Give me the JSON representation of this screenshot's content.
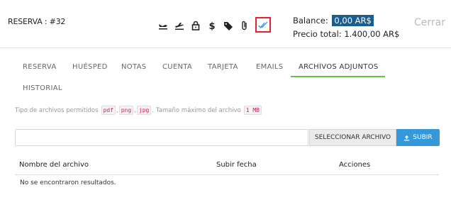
{
  "header": {
    "title": "RESERVA : #32",
    "balance_label": "Balance:",
    "balance_value": "0,00 AR$",
    "total_label": "Precio total: 1.400,00 AR$",
    "close_label": "Cerrar"
  },
  "icons": [
    "plane-arrival-icon",
    "plane-departure-icon",
    "lock-icon",
    "dollar-icon",
    "tags-icon",
    "paperclip-icon",
    "double-check-icon"
  ],
  "tabs": [
    {
      "label": "RESERVA"
    },
    {
      "label": "HUÉSPED"
    },
    {
      "label": "NOTAS"
    },
    {
      "label": "CUENTA"
    },
    {
      "label": "TARJETA"
    },
    {
      "label": "EMAILS"
    },
    {
      "label": "ARCHIVOS ADJUNTOS"
    },
    {
      "label": "HISTORIAL"
    }
  ],
  "active_tab": "ARCHIVOS ADJUNTOS",
  "info": {
    "prefix": "Tipo de archivos permitidos",
    "types": [
      "pdf",
      "png",
      "jpg"
    ],
    "size_text": "Tamaño máximo del archivo",
    "max_size": "1 MB"
  },
  "upload": {
    "select_label": "SELECCIONAR ARCHIVO",
    "upload_label": "SUBIR"
  },
  "table": {
    "columns": [
      "Nombre del archivo",
      "Subir fecha",
      "Acciones"
    ],
    "empty_text": "No se encontraron resultados."
  },
  "colors": {
    "accent_green": "#6cc04a",
    "balance_bg": "#1b5e8e",
    "upload_blue": "#3498db",
    "highlight_red": "#e8202a"
  }
}
